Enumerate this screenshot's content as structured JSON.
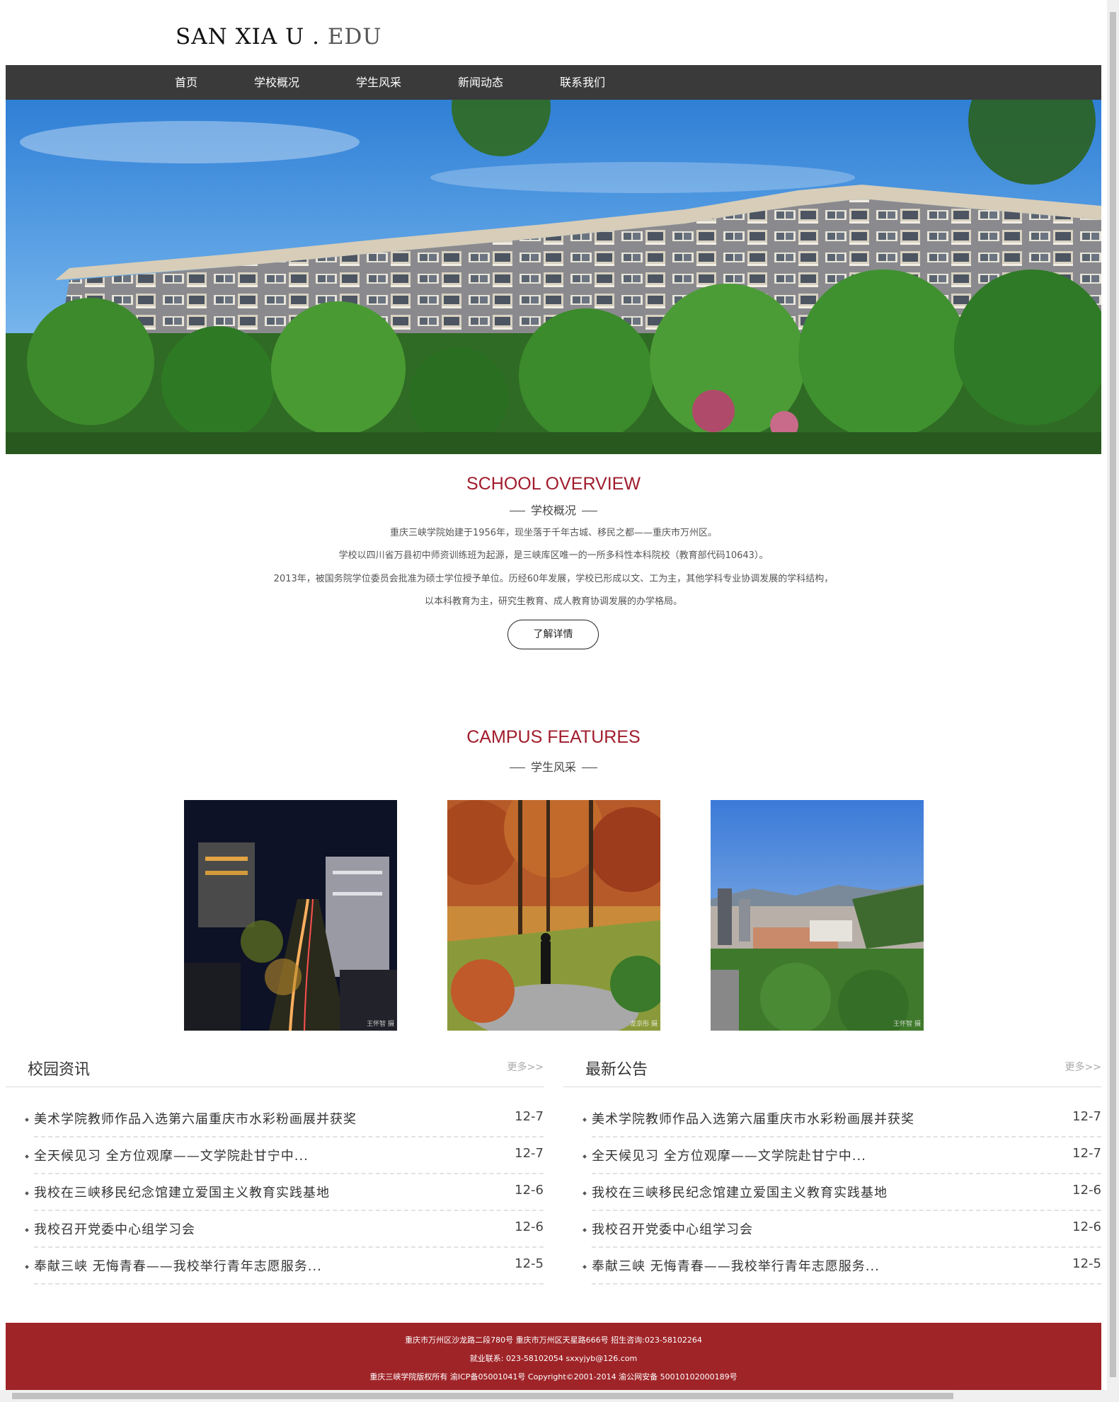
{
  "header": {
    "logo_main": "SAN XIA U . ",
    "logo_suffix": "EDU"
  },
  "nav": {
    "items": [
      "首页",
      "学校概况",
      "学生风采",
      "新闻动态",
      "联系我们"
    ]
  },
  "overview": {
    "title": "SCHOOL OVERVIEW",
    "subtitle": "学校概况",
    "lines": [
      "重庆三峡学院始建于1956年，现坐落于千年古城、移民之都——重庆市万州区。",
      "学校以四川省万县初中师资训练班为起源，是三峡库区唯一的一所多科性本科院校（教育部代码10643）。",
      "2013年，被国务院学位委员会批准为硕士学位授予单位。历经60年发展，学校已形成以文、工为主，其他学科专业协调发展的学科结构，",
      "以本科教育为主，研究生教育、成人教育协调发展的办学格局。"
    ],
    "button": "了解详情"
  },
  "campus": {
    "title": "CAMPUS FEATURES",
    "subtitle": "学生风采",
    "photos": [
      {
        "watermark": "王怀智 摄",
        "icon": "night-street-photo"
      },
      {
        "watermark": "龙京彤 摄",
        "icon": "autumn-forest-photo"
      },
      {
        "watermark": "王怀智 摄",
        "icon": "city-view-photo"
      }
    ]
  },
  "news_left": {
    "title": "校园资讯",
    "more": "更多>>",
    "items": [
      {
        "text": "美术学院教师作品入选第六届重庆市水彩粉画展并获奖",
        "date": "12-7"
      },
      {
        "text": "全天候见习 全方位观摩——文学院赴甘宁中...",
        "date": "12-7"
      },
      {
        "text": "我校在三峡移民纪念馆建立爱国主义教育实践基地",
        "date": "12-6"
      },
      {
        "text": "我校召开党委中心组学习会",
        "date": "12-6"
      },
      {
        "text": "奉献三峡 无悔青春——我校举行青年志愿服务...",
        "date": "12-5"
      }
    ]
  },
  "news_right": {
    "title": "最新公告",
    "more": "更多>>",
    "items": [
      {
        "text": "美术学院教师作品入选第六届重庆市水彩粉画展并获奖",
        "date": "12-7"
      },
      {
        "text": "全天候见习 全方位观摩——文学院赴甘宁中...",
        "date": "12-7"
      },
      {
        "text": "我校在三峡移民纪念馆建立爱国主义教育实践基地",
        "date": "12-6"
      },
      {
        "text": "我校召开党委中心组学习会",
        "date": "12-6"
      },
      {
        "text": "奉献三峡 无悔青春——我校举行青年志愿服务...",
        "date": "12-5"
      }
    ]
  },
  "footer": {
    "line1": "重庆市万州区沙龙路二段780号 重庆市万州区天星路666号 招生咨询:023-58102264",
    "line2": "就业联系: 023-58102054 sxxyjyb@126.com",
    "line3": "重庆三峡学院版权所有 渝ICP备05001041号 Copyright©2001-2014 渝公网安备 50010102000189号"
  },
  "colors": {
    "accent": "#a01c2c",
    "nav_bg": "#3a3a3a",
    "footer_bg": "#9f2428"
  }
}
